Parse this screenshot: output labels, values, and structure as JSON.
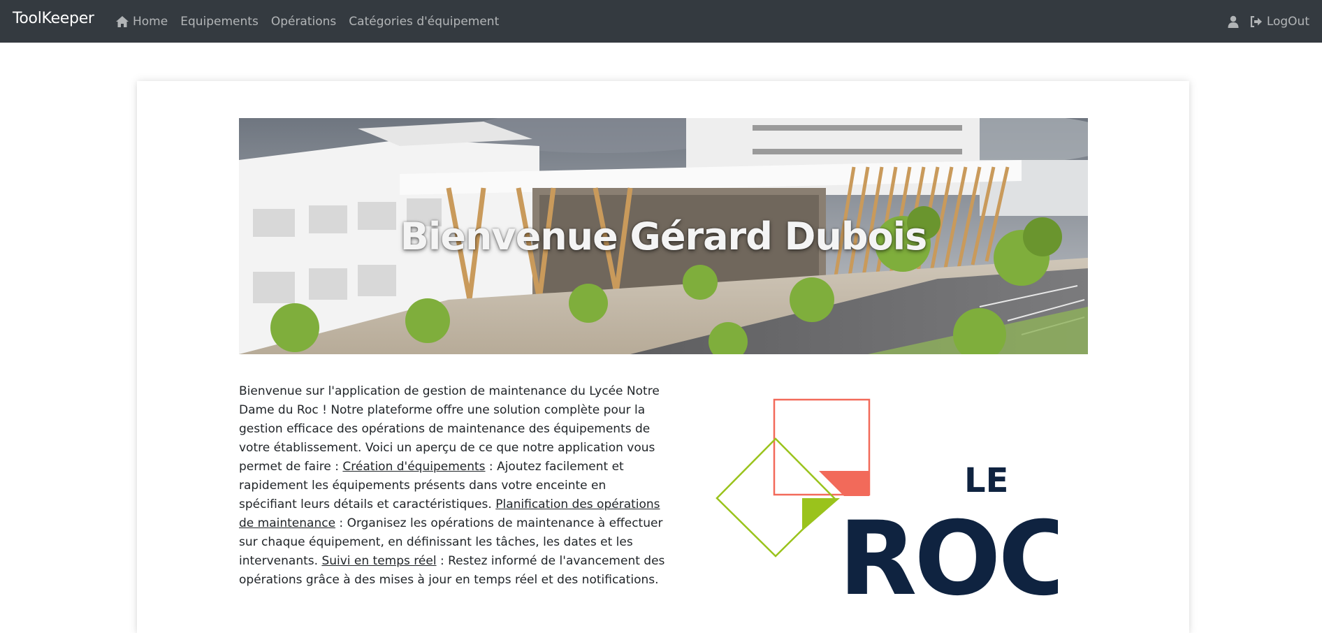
{
  "navbar": {
    "brand": "ToolKeeper",
    "links": [
      {
        "label": "Home",
        "icon": "home-icon"
      },
      {
        "label": "Equipements"
      },
      {
        "label": "Opérations"
      },
      {
        "label": "Catégories d'équipement"
      }
    ],
    "user_icon": "user-icon",
    "logout_label": "LogOut",
    "logout_icon": "sign-out-icon"
  },
  "hero": {
    "title": "Bienvenue Gérard Dubois"
  },
  "intro": {
    "p1": "Bienvenue sur l'application de gestion de maintenance du Lycée Notre Dame du Roc ! Notre plateforme offre une solution complète pour la gestion efficace des opérations de maintenance des équipements de votre établissement. Voici un aperçu de ce que notre application vous permet de faire : ",
    "link1": "Création d'équipements",
    "p2": " : Ajoutez facilement et rapidement les équipements présents dans votre enceinte en spécifiant leurs détails et caractéristiques. ",
    "link2": "Planification des opérations de maintenance",
    "p3": " : Organisez les opérations de maintenance à effectuer sur chaque équipement, en définissant les tâches, les dates et les intervenants. ",
    "link3": "Suivi en temps réel",
    "p4": " : Restez informé de l'avancement des opérations grâce à des mises à jour en temps réel et des notifications."
  },
  "logo": {
    "word_small": "LE",
    "word_big": "ROC"
  },
  "colors": {
    "navbar_bg": "#343a40",
    "logo_navy": "#0f2340",
    "logo_coral": "#f26a5a",
    "logo_green": "#9ac31c"
  }
}
